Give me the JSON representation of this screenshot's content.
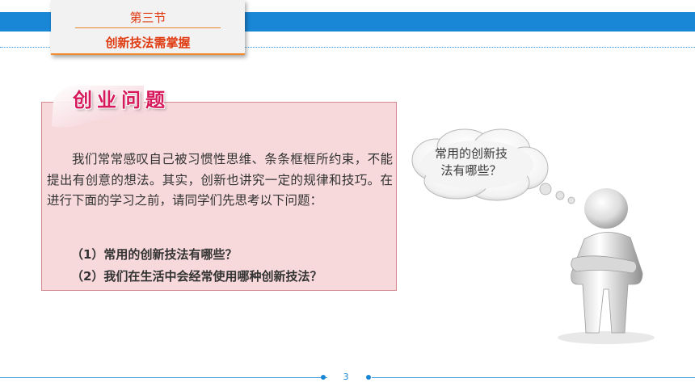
{
  "header": {
    "section_number": "第三节",
    "section_title": "创新技法需掌握"
  },
  "card": {
    "heading": "创业问题",
    "paragraph": "我们常常感叹自己被习惯性思维、条条框框所约束，不能提出有创意的想法。其实，创新也讲究一定的规律和技巧。在进行下面的学习之前，请同学们先思考以下问题：",
    "question1": "（1）常用的创新技法有哪些？",
    "question2": "（2）我们在生活中会经常使用哪种创新技法？"
  },
  "bubble": {
    "line1": "常用的创新技",
    "line2": "法有哪些？"
  },
  "footer": {
    "page_number": "3"
  },
  "colors": {
    "accent_blue": "#1a86d6",
    "heading_pink": "#d6195b",
    "section_red": "#e03a10",
    "card_bg": "#f7d9dc"
  },
  "icons": {
    "thinking_figure": "thinking-person-illustration",
    "thought_bubble": "thought-cloud-icon"
  }
}
